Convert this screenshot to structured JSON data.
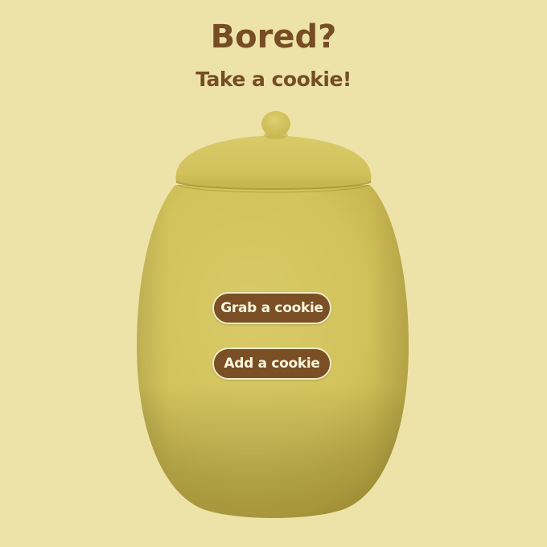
{
  "header": {
    "title": "Bored?",
    "subtitle": "Take a cookie!"
  },
  "actions": {
    "grab_label": "Grab a cookie",
    "add_label": "Add a cookie"
  },
  "colors": {
    "background": "#ede3a9",
    "text": "#764d24",
    "jar": "#d6c65f",
    "button": "#7a4f25",
    "button_text": "#fbf6dc"
  }
}
